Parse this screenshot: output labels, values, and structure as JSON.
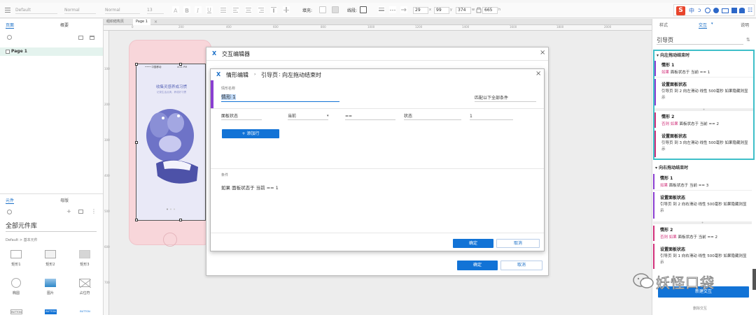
{
  "toolbar": {
    "font": "Default",
    "weight": "Normal",
    "style": "Normal",
    "size": "13",
    "fill_label": "填充:",
    "line_label": "线段:",
    "x": "29",
    "y": "99",
    "w": "374",
    "h": "665",
    "x_label": "x",
    "y_label": "y",
    "w_label": "w",
    "h_label": "h"
  },
  "left_panel": {
    "tab_pages": "页面",
    "tab_outline": "概要",
    "page_name": "Page 1",
    "tab_widgets": "元件",
    "tab_masters": "母版",
    "library_name": "全部元件库",
    "library_sub": "Default > 基本元件",
    "widgets": [
      "矩形1",
      "矩形2",
      "矩形3",
      "椭圆",
      "图片",
      "占位符"
    ],
    "widget_buttons": [
      "BUTTON",
      "BUTTON",
      "BUTTON"
    ]
  },
  "canvas": {
    "tabs": [
      "组织结构页",
      "Page 1"
    ],
    "ruler_ticks": [
      "0",
      "200",
      "400",
      "600",
      "800",
      "1000",
      "1200",
      "1400",
      "1600",
      "1800",
      "2000"
    ],
    "vruler_ticks": [
      "100",
      "200",
      "300",
      "400",
      "500",
      "600",
      "700"
    ],
    "screen_status": "•••• 中国移动",
    "screen_time": "4:21 PM",
    "screen_title": "收集灵感养成习惯",
    "screen_sub": "记录生活点滴，养成好习惯"
  },
  "interaction_dialog": {
    "title": "交互编辑器",
    "ok": "确定",
    "cancel": "取消"
  },
  "case_dialog": {
    "title": "情形编辑",
    "breadcrumb_page": "引导页",
    "breadcrumb_event": "向左拖动结束时",
    "case_name_label": "情形名称",
    "case_name": "情形 1",
    "match_option": "匹配以下全部条件",
    "cond_row": {
      "field1": "面板状态",
      "field2": "当前",
      "op": "==",
      "field3": "状态",
      "value": "1"
    },
    "add_row": "+ 添加行",
    "condition_label": "条件",
    "condition_text": "如果 面板状态于 当前 == 1",
    "ok": "确定",
    "cancel": "取消"
  },
  "right_panel": {
    "tab_style": "样式",
    "tab_interaction": "交互",
    "tab_notes": "说明",
    "widget_name": "引导页",
    "event1": "向左拖动结束时",
    "event2": "向右拖动结束时",
    "case1_title": "情形 1",
    "case1_cond_kw": "如果",
    "case1_cond": "面板状态于 当前 == 1",
    "action_title": "设置面板状态",
    "case1_action": "引导页 到 2 向左滑动 线性 500毫秒 如果隐藏则显示",
    "case2_title": "情形 2",
    "case2_cond_kw": "否则 如果",
    "case2_cond": "面板状态于 当前 == 2",
    "case2_action": "引导页 到 3 向左滑动 线性 500毫秒 如果隐藏则显示",
    "r_case1_cond": "面板状态于 当前 == 3",
    "r_case1_action": "引导页 到 2 向右滑动 线性 500毫秒 如果隐藏则显示",
    "r_case2_cond": "面板状态于 当前 == 2",
    "r_case2_action": "引导页 到 1 向右滑动 线性 500毫秒 如果隐藏则显示",
    "new_interaction": "新建交互",
    "bottom_link": "删除交互"
  },
  "watermark": "妖怪口袋",
  "colors": {
    "accent": "#1273d6",
    "case_bar": "#8a3fd1",
    "case_bar2": "#d0307a",
    "selection": "#3ebfc9"
  }
}
